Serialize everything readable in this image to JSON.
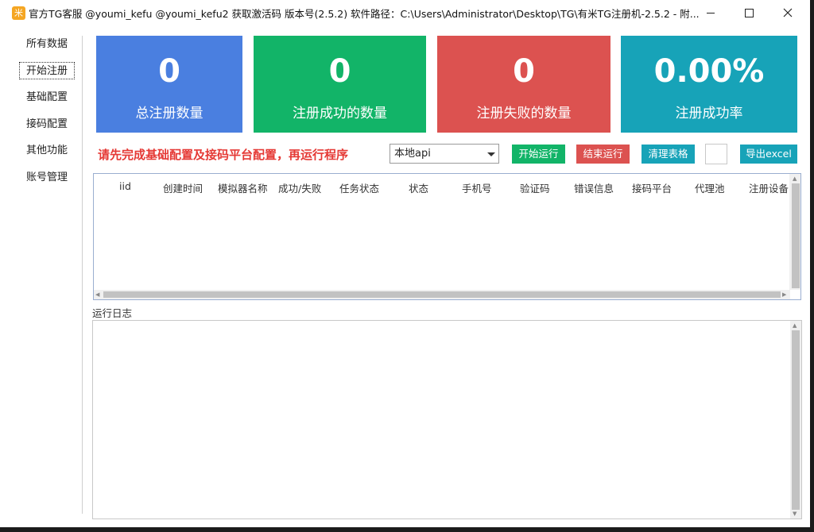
{
  "window": {
    "title": "官方TG客服 @youmi_kefu @youmi_kefu2 获取激活码 版本号(2.5.2) 软件路径：C:\\Users\\Administrator\\Desktop\\TG\\有米TG注册机-2.5.2  - 附...",
    "icon_glyph": "米"
  },
  "sidebar": {
    "items": [
      {
        "label": "所有数据"
      },
      {
        "label": "开始注册",
        "active": true
      },
      {
        "label": "基础配置"
      },
      {
        "label": "接码配置"
      },
      {
        "label": "其他功能"
      },
      {
        "label": "账号管理"
      }
    ]
  },
  "stats": [
    {
      "value": "0",
      "label": "总注册数量",
      "color": "#4a7fe0"
    },
    {
      "value": "0",
      "label": "注册成功的数量",
      "color": "#12b468"
    },
    {
      "value": "0",
      "label": "注册失败的数量",
      "color": "#dc5250"
    },
    {
      "value": "0.00%",
      "label": "注册成功率",
      "color": "#17a3b8"
    }
  ],
  "controls": {
    "notice": "请先完成基础配置及接码平台配置，再运行程序",
    "api_select": "本地api",
    "start_label": "开始运行",
    "stop_label": "结束运行",
    "clear_label": "清理表格",
    "export_label": "导出excel"
  },
  "table": {
    "columns": [
      "iid",
      "创建时间",
      "模拟器名称",
      "成功/失败",
      "任务状态",
      "状态",
      "手机号",
      "验证码",
      "错误信息",
      "接码平台",
      "代理池",
      "注册设备"
    ]
  },
  "log": {
    "label": "运行日志"
  },
  "colors": {
    "start": "#12b468",
    "stop": "#dc5250",
    "clear": "#17a3b8",
    "export": "#17a3b8",
    "notice": "#e53935"
  }
}
